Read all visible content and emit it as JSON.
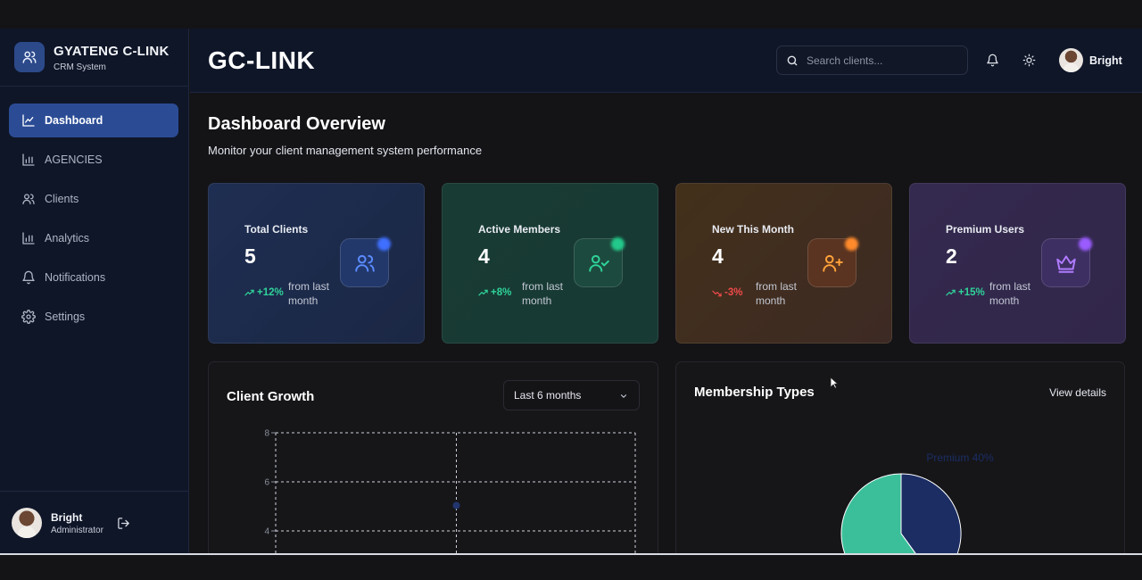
{
  "brand": {
    "title": "GYATENG C-LINK",
    "subtitle": "CRM System"
  },
  "nav": [
    {
      "label": "Dashboard",
      "icon": "line-chart-icon",
      "active": true
    },
    {
      "label": "AGENCIES",
      "icon": "bar-chart-icon",
      "active": false
    },
    {
      "label": "Clients",
      "icon": "users-icon",
      "active": false
    },
    {
      "label": "Analytics",
      "icon": "bar-chart-icon",
      "active": false
    },
    {
      "label": "Notifications",
      "icon": "bell-icon",
      "active": false
    },
    {
      "label": "Settings",
      "icon": "gear-icon",
      "active": false
    }
  ],
  "sidebar_user": {
    "name": "Bright",
    "role": "Administrator"
  },
  "header": {
    "logo": "GC-LINK",
    "search_placeholder": "Search clients...",
    "user_name": "Bright"
  },
  "page": {
    "title": "Dashboard Overview",
    "subtitle": "Monitor your client management system performance"
  },
  "stats": [
    {
      "label": "Total Clients",
      "value": "5",
      "trend": "+12%",
      "trend_dir": "up",
      "note": "from last month",
      "icon": "users-icon",
      "accent": "#5b8cff"
    },
    {
      "label": "Active Members",
      "value": "4",
      "trend": "+8%",
      "trend_dir": "up",
      "note": "from last month",
      "icon": "user-check-icon",
      "accent": "#2fd39a"
    },
    {
      "label": "New This Month",
      "value": "4",
      "trend": "-3%",
      "trend_dir": "down",
      "note": "from last month",
      "icon": "user-plus-icon",
      "accent": "#ffa23a"
    },
    {
      "label": "Premium Users",
      "value": "2",
      "trend": "+15%",
      "trend_dir": "up",
      "note": "from last month",
      "icon": "crown-icon",
      "accent": "#b07bff"
    }
  ],
  "colors": {
    "up": "#2fd39a",
    "down": "#f04a4a",
    "active_nav": "#2b4c95"
  },
  "growth_panel": {
    "title": "Client Growth",
    "range_selected": "Last 6 months"
  },
  "membership_panel": {
    "title": "Membership Types",
    "link": "View details"
  },
  "chart_data": [
    {
      "type": "line",
      "title": "Client Growth",
      "y_ticks": [
        "8",
        "6",
        "4"
      ],
      "ylim": [
        0,
        8
      ],
      "grid": true,
      "series": [
        {
          "values": [
            5
          ]
        }
      ]
    },
    {
      "type": "pie",
      "title": "Membership Types",
      "slices": [
        {
          "label": "Premium 40%",
          "value": 40,
          "color": "#1b2d63"
        },
        {
          "label": "",
          "value": 60,
          "color": "#3bbf9a"
        }
      ]
    }
  ]
}
